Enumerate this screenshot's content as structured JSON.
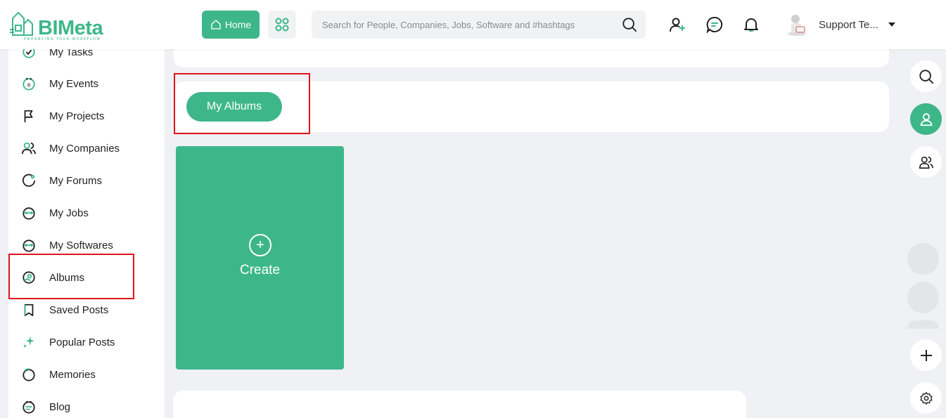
{
  "colors": {
    "brand": "#3db78a",
    "highlight": "#e0141b",
    "background": "#f0f1f5"
  },
  "header": {
    "logo_text": "BIMeta",
    "logo_tagline": "ENHANCING YOUR WORKFLOW",
    "home_label": "Home",
    "search_placeholder": "Search for People, Companies, Jobs, Software and #hashtags",
    "user_name": "Support Te..."
  },
  "sidebar": {
    "items": [
      {
        "label": "My Tasks",
        "icon": "tasks-icon"
      },
      {
        "label": "My Events",
        "icon": "calendar-icon"
      },
      {
        "label": "My Projects",
        "icon": "flag-icon"
      },
      {
        "label": "My Companies",
        "icon": "users-icon"
      },
      {
        "label": "My Forums",
        "icon": "forum-icon"
      },
      {
        "label": "My Jobs",
        "icon": "briefcase-icon"
      },
      {
        "label": "My Softwares",
        "icon": "software-icon"
      },
      {
        "label": "Albums",
        "icon": "album-icon"
      },
      {
        "label": "Saved Posts",
        "icon": "bookmark-icon"
      },
      {
        "label": "Popular Posts",
        "icon": "sparkle-icon"
      },
      {
        "label": "Memories",
        "icon": "memories-icon"
      },
      {
        "label": "Blog",
        "icon": "blog-icon"
      }
    ]
  },
  "main": {
    "albums_tab_label": "My Albums",
    "create_label": "Create"
  }
}
